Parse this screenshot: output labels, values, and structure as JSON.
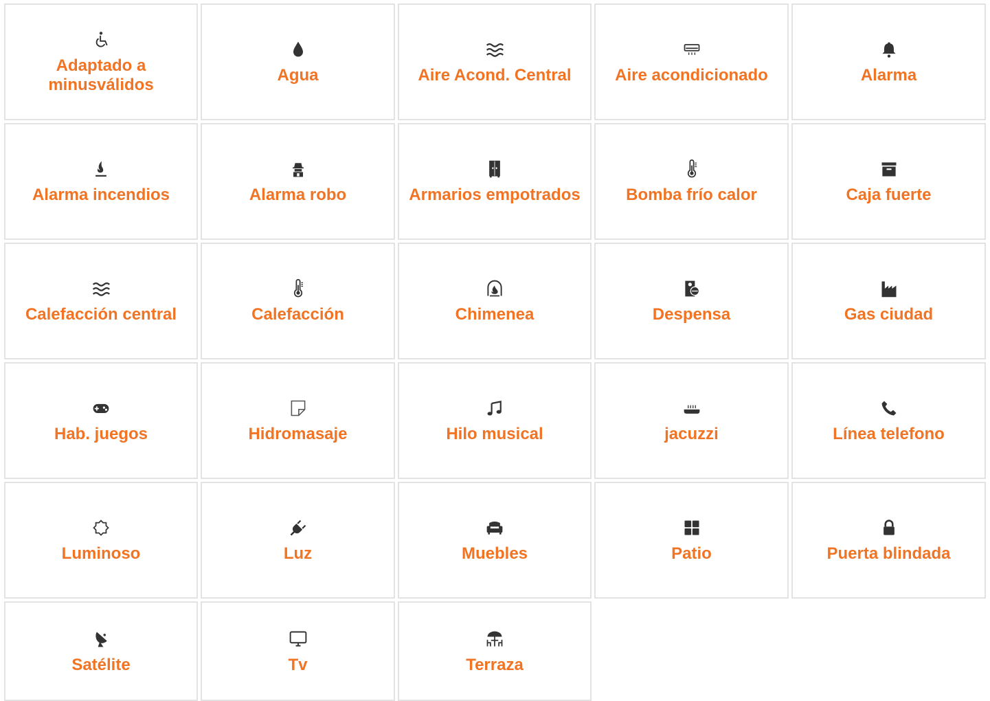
{
  "accent_color": "#f07424",
  "icon_color": "#333333",
  "features": [
    {
      "label": "Adaptado a minusválidos",
      "icon": "wheelchair-icon"
    },
    {
      "label": "Agua",
      "icon": "water-drop-icon"
    },
    {
      "label": "Aire Acond. Central",
      "icon": "waves-icon"
    },
    {
      "label": "Aire acondicionado",
      "icon": "air-conditioner-icon"
    },
    {
      "label": "Alarma",
      "icon": "bell-icon"
    },
    {
      "label": "Alarma incendios",
      "icon": "flame-icon"
    },
    {
      "label": "Alarma robo",
      "icon": "thief-icon"
    },
    {
      "label": "Armarios empotrados",
      "icon": "wardrobe-icon"
    },
    {
      "label": "Bomba frío calor",
      "icon": "thermometer-icon"
    },
    {
      "label": "Caja fuerte",
      "icon": "safe-box-icon"
    },
    {
      "label": "Calefacción central",
      "icon": "waves-icon"
    },
    {
      "label": "Calefacción",
      "icon": "thermometer-icon"
    },
    {
      "label": "Chimenea",
      "icon": "fireplace-icon"
    },
    {
      "label": "Despensa",
      "icon": "pantry-icon"
    },
    {
      "label": "Gas ciudad",
      "icon": "factory-icon"
    },
    {
      "label": "Hab. juegos",
      "icon": "gamepad-icon"
    },
    {
      "label": "Hidromasaje",
      "icon": "sticky-note-icon"
    },
    {
      "label": "Hilo musical",
      "icon": "music-note-icon"
    },
    {
      "label": "jacuzzi",
      "icon": "hot-tub-icon"
    },
    {
      "label": "Línea telefono",
      "icon": "phone-icon"
    },
    {
      "label": "Luminoso",
      "icon": "sun-icon"
    },
    {
      "label": "Luz",
      "icon": "plug-icon"
    },
    {
      "label": "Muebles",
      "icon": "armchair-icon"
    },
    {
      "label": "Patio",
      "icon": "grid-icon"
    },
    {
      "label": "Puerta blindada",
      "icon": "lock-icon"
    },
    {
      "label": "Satélite",
      "icon": "satellite-dish-icon"
    },
    {
      "label": "Tv",
      "icon": "monitor-icon"
    },
    {
      "label": "Terraza",
      "icon": "terrace-icon"
    }
  ]
}
